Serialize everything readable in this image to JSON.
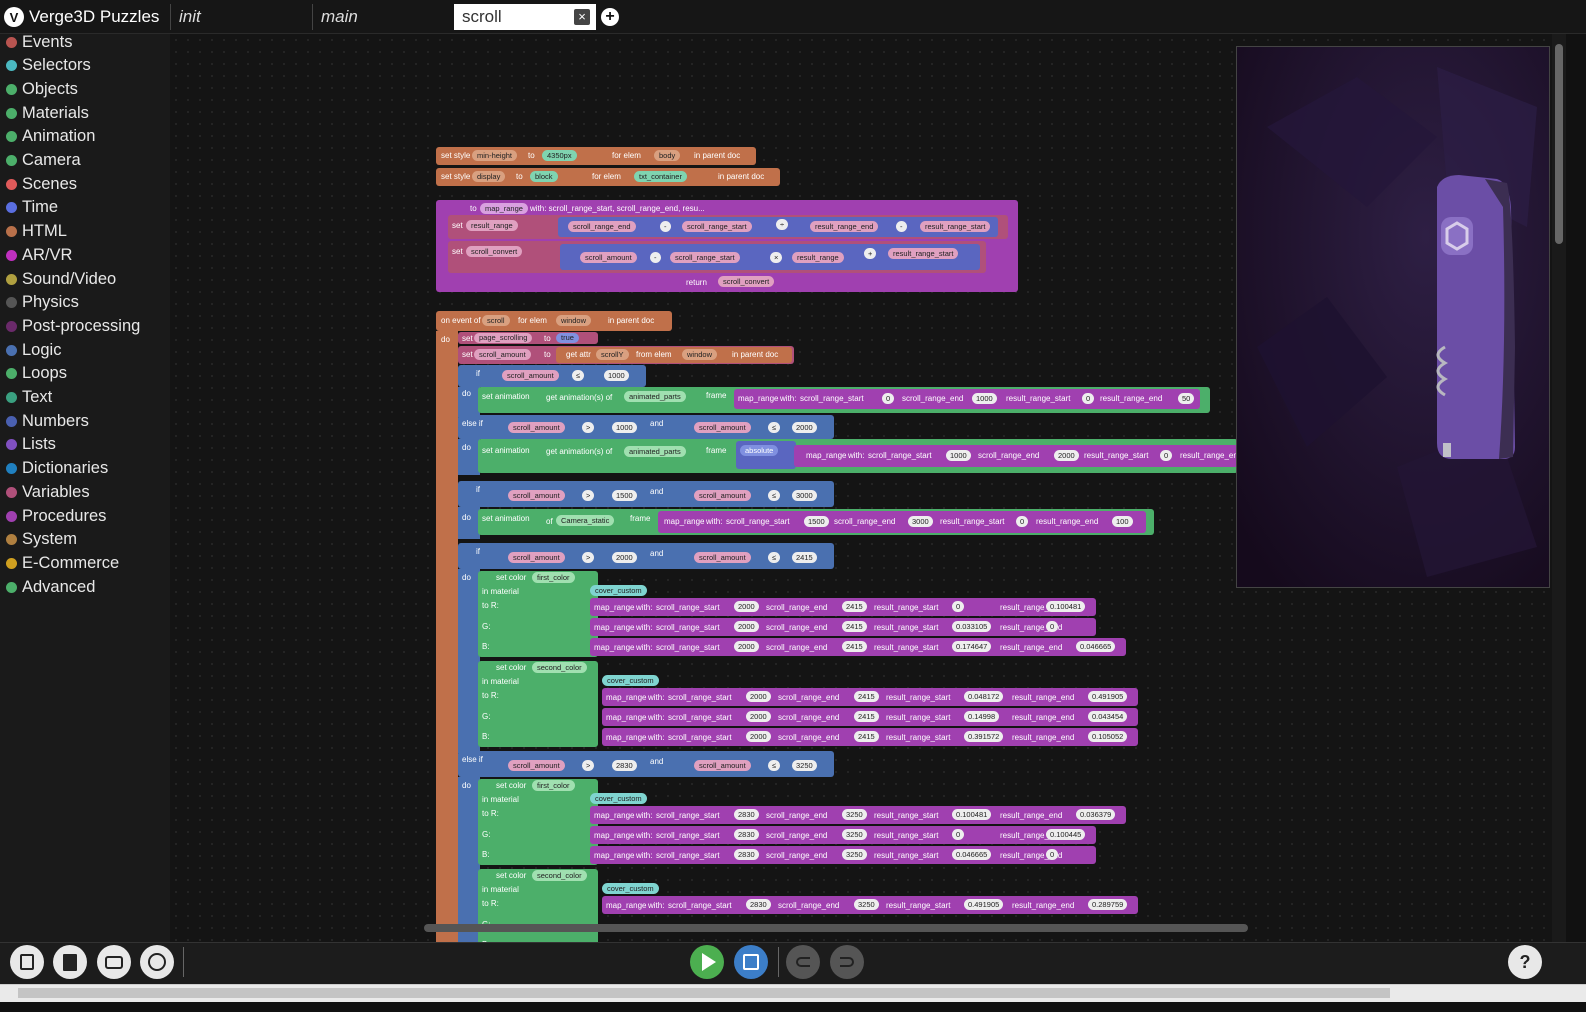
{
  "app": {
    "title": "Verge3D Puzzles"
  },
  "tabs": [
    {
      "label": "init"
    },
    {
      "label": "main"
    },
    {
      "label": "scroll",
      "close": "×"
    }
  ],
  "add_tab_icon": "+",
  "sidebar": {
    "categories": [
      {
        "label": "Events",
        "color": "#b85450"
      },
      {
        "label": "Selectors",
        "color": "#4bb8c0"
      },
      {
        "label": "Objects",
        "color": "#4caf6a"
      },
      {
        "label": "Materials",
        "color": "#4caf6a"
      },
      {
        "label": "Animation",
        "color": "#4caf6a"
      },
      {
        "label": "Camera",
        "color": "#4caf6a"
      },
      {
        "label": "Scenes",
        "color": "#e05a5a"
      },
      {
        "label": "Time",
        "color": "#5a6ee0"
      },
      {
        "label": "HTML",
        "color": "#b8704a"
      },
      {
        "label": "AR/VR",
        "color": "#c030c0"
      },
      {
        "label": "Sound/Video",
        "color": "#b0a040"
      },
      {
        "label": "Physics",
        "color": "#555555"
      },
      {
        "label": "Post-processing",
        "color": "#6a2a6a"
      },
      {
        "label": "Logic",
        "color": "#4a70b0"
      },
      {
        "label": "Loops",
        "color": "#4caf6a"
      },
      {
        "label": "Text",
        "color": "#3aa080"
      },
      {
        "label": "Numbers",
        "color": "#4a60b0"
      },
      {
        "label": "Lists",
        "color": "#8050c0"
      },
      {
        "label": "Dictionaries",
        "color": "#2080c0"
      },
      {
        "label": "Variables",
        "color": "#b0507a"
      },
      {
        "label": "Procedures",
        "color": "#a040b0"
      },
      {
        "label": "System",
        "color": "#b08040"
      },
      {
        "label": "E-Commerce",
        "color": "#d0a020"
      },
      {
        "label": "Advanced",
        "color": "#4caf6a"
      }
    ]
  },
  "blocks": {
    "s1": {
      "set": "set style",
      "prop": "min-height",
      "to": "to",
      "val": "4350px",
      "for": "for elem",
      "elem": "body",
      "parent": "in parent doc"
    },
    "s2": {
      "set": "set style",
      "prop": "display",
      "to": "to",
      "val": "block",
      "for": "for elem",
      "elem": "txt_container",
      "parent": "in parent doc"
    },
    "fn": {
      "to": "to",
      "name": "map_range",
      "args": "with: scroll_range_start, scroll_range_end, resu...",
      "set": "set",
      "v1": "result_range",
      "v2": "scroll_convert",
      "a": "scroll_range_end",
      "b": "scroll_range_start",
      "c": "result_range_end",
      "d": "result_range_start",
      "e": "scroll_amount",
      "f": "scroll_range_start",
      "g": "result_range",
      "h": "result_range_start",
      "minus": "-",
      "div": "÷",
      "mul": "×",
      "plus": "+",
      "ret": "return",
      "retv": "scroll_convert"
    },
    "ev": {
      "on": "on event of",
      "evt": "scroll",
      "for": "for elem",
      "elem": "window",
      "parent": "in parent doc",
      "do": "do",
      "set": "set",
      "ps": "page_scrolling",
      "to": "to",
      "tr": "true",
      "sa": "scroll_amount",
      "getattr": "get attr",
      "attr": "scrollY",
      "fromelem": "from elem",
      "win": "window",
      "if": "if",
      "elseif": "else if",
      "and": "and",
      "le": "≤",
      "gt": ">",
      "n1000": "1000",
      "n1500": "1500",
      "n2000": "2000",
      "n3000": "3000",
      "n2415": "2415",
      "n2830": "2830",
      "n3250": "3250",
      "setanim": "set animation",
      "getanim": "get animation(s) of",
      "parts": "animated_parts",
      "frame": "frame",
      "absolute": "absolute",
      "of": "of",
      "cam": "Camera_static",
      "mr": "map_range",
      "with": "with:",
      "srs": "scroll_range_start",
      "sre": "scroll_range_end",
      "rrs": "result_range_start",
      "rre": "result_range_end",
      "n0": "0",
      "n50": "50",
      "n100": "100",
      "setcolor": "set color",
      "c1": "first_color",
      "c2": "second_color",
      "inmat": "in material",
      "mat": "cover_custom",
      "toR": "to R:",
      "G": "G:",
      "B": "B:",
      "v": [
        "0.100481",
        "0.033105",
        "0.174647",
        "0.046665",
        "0.048172",
        "0.491905",
        "0.14998",
        "0.043454",
        "0.391572",
        "0.105052",
        "0.036379",
        "0.100445",
        "0.289759"
      ]
    }
  },
  "bottom": {
    "help": "?"
  }
}
